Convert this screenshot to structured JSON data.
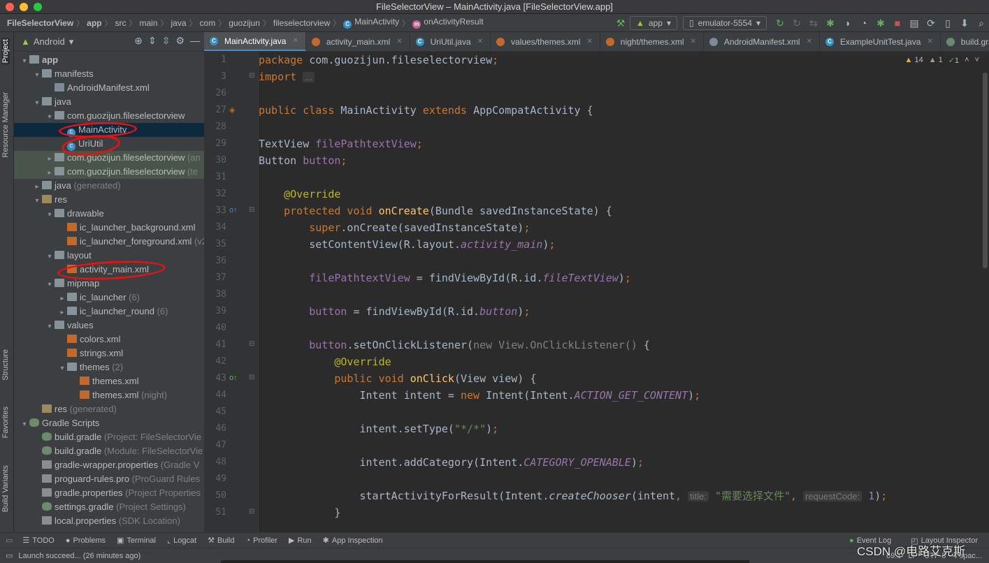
{
  "window": {
    "title": "FileSelectorView – MainActivity.java [FileSelectorView.app]"
  },
  "breadcrumb": [
    "FileSelectorView",
    "app",
    "src",
    "main",
    "java",
    "com",
    "guozijun",
    "fileselectorview",
    "MainActivity",
    "onActivityResult"
  ],
  "toolbar": {
    "run_config": "app",
    "device": "emulator-5554"
  },
  "left_strip": {
    "project": "Project",
    "resource_manager": "Resource Manager",
    "structure": "Structure",
    "favorites": "Favorites",
    "build_variants": "Build Variants"
  },
  "project_panel": {
    "view_mode": "Android"
  },
  "tree": [
    {
      "label": "app",
      "suffix": "",
      "indent": 0,
      "arrow": "v",
      "icon": "folder",
      "bold": true
    },
    {
      "label": "manifests",
      "suffix": "",
      "indent": 1,
      "arrow": "v",
      "icon": "folder"
    },
    {
      "label": "AndroidManifest.xml",
      "suffix": "",
      "indent": 2,
      "arrow": "",
      "icon": "mf"
    },
    {
      "label": "java",
      "suffix": "",
      "indent": 1,
      "arrow": "v",
      "icon": "folder"
    },
    {
      "label": "com.guozijun.fileselectorview",
      "suffix": "",
      "indent": 2,
      "arrow": "v",
      "icon": "folder"
    },
    {
      "label": "MainActivity",
      "suffix": "",
      "indent": 3,
      "arrow": "",
      "icon": "cls",
      "selected": true
    },
    {
      "label": "UriUtil",
      "suffix": "",
      "indent": 3,
      "arrow": "",
      "icon": "cls"
    },
    {
      "label": "com.guozijun.fileselectorview",
      "suffix": " (an",
      "indent": 2,
      "arrow": ">",
      "icon": "folder",
      "tinted": true
    },
    {
      "label": "com.guozijun.fileselectorview",
      "suffix": " (te",
      "indent": 2,
      "arrow": ">",
      "icon": "folder",
      "tinted": true
    },
    {
      "label": "java",
      "suffix": " (generated)",
      "indent": 1,
      "arrow": ">",
      "icon": "folder"
    },
    {
      "label": "res",
      "suffix": "",
      "indent": 1,
      "arrow": "v",
      "icon": "res"
    },
    {
      "label": "drawable",
      "suffix": "",
      "indent": 2,
      "arrow": "v",
      "icon": "folder"
    },
    {
      "label": "ic_launcher_background.xml",
      "suffix": "",
      "indent": 3,
      "arrow": "",
      "icon": "xml"
    },
    {
      "label": "ic_launcher_foreground.xml",
      "suffix": " (v2",
      "indent": 3,
      "arrow": "",
      "icon": "xml"
    },
    {
      "label": "layout",
      "suffix": "",
      "indent": 2,
      "arrow": "v",
      "icon": "folder"
    },
    {
      "label": "activity_main.xml",
      "suffix": "",
      "indent": 3,
      "arrow": "",
      "icon": "xml"
    },
    {
      "label": "mipmap",
      "suffix": "",
      "indent": 2,
      "arrow": "v",
      "icon": "folder"
    },
    {
      "label": "ic_launcher",
      "suffix": " (6)",
      "indent": 3,
      "arrow": ">",
      "icon": "folder"
    },
    {
      "label": "ic_launcher_round",
      "suffix": " (6)",
      "indent": 3,
      "arrow": ">",
      "icon": "folder"
    },
    {
      "label": "values",
      "suffix": "",
      "indent": 2,
      "arrow": "v",
      "icon": "folder"
    },
    {
      "label": "colors.xml",
      "suffix": "",
      "indent": 3,
      "arrow": "",
      "icon": "xml"
    },
    {
      "label": "strings.xml",
      "suffix": "",
      "indent": 3,
      "arrow": "",
      "icon": "xml"
    },
    {
      "label": "themes",
      "suffix": " (2)",
      "indent": 3,
      "arrow": "v",
      "icon": "folder"
    },
    {
      "label": "themes.xml",
      "suffix": "",
      "indent": 4,
      "arrow": "",
      "icon": "xml"
    },
    {
      "label": "themes.xml",
      "suffix": " (night)",
      "indent": 4,
      "arrow": "",
      "icon": "xml"
    },
    {
      "label": "res",
      "suffix": " (generated)",
      "indent": 1,
      "arrow": "",
      "icon": "res"
    },
    {
      "label": "Gradle Scripts",
      "suffix": "",
      "indent": 0,
      "arrow": "v",
      "icon": "gradle"
    },
    {
      "label": "build.gradle",
      "suffix": " (Project: FileSelectorVie",
      "indent": 1,
      "arrow": "",
      "icon": "gradle"
    },
    {
      "label": "build.gradle",
      "suffix": " (Module: FileSelectorVie",
      "indent": 1,
      "arrow": "",
      "icon": "gradle"
    },
    {
      "label": "gradle-wrapper.properties",
      "suffix": " (Gradle V",
      "indent": 1,
      "arrow": "",
      "icon": "prop"
    },
    {
      "label": "proguard-rules.pro",
      "suffix": " (ProGuard Rules",
      "indent": 1,
      "arrow": "",
      "icon": "prop"
    },
    {
      "label": "gradle.properties",
      "suffix": " (Project Properties",
      "indent": 1,
      "arrow": "",
      "icon": "prop"
    },
    {
      "label": "settings.gradle",
      "suffix": " (Project Settings)",
      "indent": 1,
      "arrow": "",
      "icon": "gradle"
    },
    {
      "label": "local.properties",
      "suffix": " (SDK Location)",
      "indent": 1,
      "arrow": "",
      "icon": "prop"
    }
  ],
  "tabs": [
    {
      "label": "MainActivity.java",
      "icon": "cls",
      "active": true
    },
    {
      "label": "activity_main.xml",
      "icon": "xml"
    },
    {
      "label": "UriUtil.java",
      "icon": "cls"
    },
    {
      "label": "values/themes.xml",
      "icon": "xml"
    },
    {
      "label": "night/themes.xml",
      "icon": "xml"
    },
    {
      "label": "AndroidManifest.xml",
      "icon": "mf"
    },
    {
      "label": "ExampleUnitTest.java",
      "icon": "cls"
    },
    {
      "label": "build.gradle (:app)",
      "icon": "gradle"
    }
  ],
  "inspections": {
    "warnings": "14",
    "weak_warnings": "1",
    "ok": "1"
  },
  "code_lines": [
    {
      "n": "1",
      "t": [
        [
          "package ",
          "kw"
        ],
        [
          "com.guozijun.fileselectorview",
          ""
        ],
        [
          ";",
          "kw"
        ]
      ]
    },
    {
      "n": "3",
      "t": [
        [
          "import ",
          "kw"
        ],
        [
          "...",
          "hint"
        ]
      ]
    },
    {
      "n": "26",
      "t": []
    },
    {
      "n": "27",
      "t": [
        [
          "public class ",
          "kw"
        ],
        [
          "MainActivity ",
          ""
        ],
        [
          "extends ",
          "kw"
        ],
        [
          "AppCompatActivity {",
          ""
        ]
      ]
    },
    {
      "n": "28",
      "t": []
    },
    {
      "n": "29",
      "t": [
        [
          "TextView ",
          ""
        ],
        [
          "filePathtextView",
          "fld"
        ],
        [
          ";",
          "kw"
        ]
      ]
    },
    {
      "n": "30",
      "t": [
        [
          "Button ",
          ""
        ],
        [
          "button",
          "fld"
        ],
        [
          ";",
          "kw"
        ]
      ]
    },
    {
      "n": "31",
      "t": []
    },
    {
      "n": "32",
      "t": [
        [
          "    @Override",
          "ann"
        ]
      ]
    },
    {
      "n": "33",
      "t": [
        [
          "    protected void ",
          "kw"
        ],
        [
          "onCreate",
          "fn"
        ],
        [
          "(Bundle savedInstanceState) {",
          ""
        ]
      ]
    },
    {
      "n": "34",
      "t": [
        [
          "        super",
          "kw"
        ],
        [
          ".onCreate(savedInstanceState)",
          ""
        ],
        [
          ";",
          "kw"
        ]
      ]
    },
    {
      "n": "35",
      "t": [
        [
          "        setContentView(R.layout.",
          ""
        ],
        [
          "activity_main",
          "ital"
        ],
        [
          ")",
          ""
        ],
        [
          ";",
          "kw"
        ]
      ]
    },
    {
      "n": "36",
      "t": []
    },
    {
      "n": "37",
      "t": [
        [
          "        filePathtextView",
          "fld"
        ],
        [
          " = findViewById(R.id.",
          ""
        ],
        [
          "fileTextView",
          "ital"
        ],
        [
          ")",
          ""
        ],
        [
          ";",
          "kw"
        ]
      ]
    },
    {
      "n": "38",
      "t": []
    },
    {
      "n": "39",
      "t": [
        [
          "        button",
          "fld"
        ],
        [
          " = findViewById(R.id.",
          ""
        ],
        [
          "button",
          "ital"
        ],
        [
          ")",
          ""
        ],
        [
          ";",
          "kw"
        ]
      ]
    },
    {
      "n": "40",
      "t": []
    },
    {
      "n": "41",
      "t": [
        [
          "        button",
          "fld"
        ],
        [
          ".setOnClickListener(",
          ""
        ],
        [
          "new View.OnClickListener()",
          "dimtext"
        ],
        [
          " {",
          ""
        ]
      ]
    },
    {
      "n": "42",
      "t": [
        [
          "            @Override",
          "ann"
        ]
      ]
    },
    {
      "n": "43",
      "t": [
        [
          "            public void ",
          "kw"
        ],
        [
          "onClick",
          "fn"
        ],
        [
          "(View view) {",
          ""
        ]
      ]
    },
    {
      "n": "44",
      "t": [
        [
          "                Intent intent = ",
          ""
        ],
        [
          "new ",
          "kw"
        ],
        [
          "Intent(Intent.",
          ""
        ],
        [
          "ACTION_GET_CONTENT",
          "ital"
        ],
        [
          ")",
          ""
        ],
        [
          ";",
          "kw"
        ]
      ]
    },
    {
      "n": "45",
      "t": []
    },
    {
      "n": "46",
      "t": [
        [
          "                intent.setType(",
          ""
        ],
        [
          "\"*/*\"",
          "str"
        ],
        [
          ")",
          ""
        ],
        [
          ";",
          "kw"
        ]
      ]
    },
    {
      "n": "47",
      "t": []
    },
    {
      "n": "48",
      "t": [
        [
          "                intent.addCategory(Intent.",
          ""
        ],
        [
          "CATEGORY_OPENABLE",
          "ital"
        ],
        [
          ")",
          ""
        ],
        [
          ";",
          "kw"
        ]
      ]
    },
    {
      "n": "49",
      "t": []
    },
    {
      "n": "50",
      "t": [
        [
          "                startActivityForResult(Intent.",
          ""
        ],
        [
          "createChooser",
          "mi"
        ],
        [
          "(intent",
          ""
        ],
        [
          ", ",
          "kw"
        ],
        [
          "title:",
          "hint"
        ],
        [
          " ",
          ""
        ],
        [
          "\"需要选择文件\"",
          "str"
        ],
        [
          ", ",
          "kw"
        ],
        [
          "requestCode:",
          "hint"
        ],
        [
          " ",
          ""
        ],
        [
          "1",
          "num"
        ],
        [
          ")",
          ""
        ],
        [
          ";",
          "kw"
        ]
      ]
    },
    {
      "n": "51",
      "t": [
        [
          "            }",
          ""
        ]
      ]
    }
  ],
  "bottom_tools": [
    {
      "label": "TODO",
      "icon": "list-icon"
    },
    {
      "label": "Problems",
      "icon": "problems-icon"
    },
    {
      "label": "Terminal",
      "icon": "terminal-icon"
    },
    {
      "label": "Logcat",
      "icon": "logcat-icon"
    },
    {
      "label": "Build",
      "icon": "hammer-icon"
    },
    {
      "label": "Profiler",
      "icon": "profiler-icon"
    },
    {
      "label": "Run",
      "icon": "run-icon"
    },
    {
      "label": "App Inspection",
      "icon": "inspection-icon"
    }
  ],
  "bottom_right": {
    "event_log": "Event Log",
    "layout_inspector": "Layout Inspector"
  },
  "status": {
    "message": "Launch succeed... (26 minutes ago)",
    "position": "69:1",
    "line_sep": "LF",
    "encoding": "UTF-8",
    "indent": "4 spac..."
  },
  "watermark": "CSDN @电路艾克斯",
  "colors": {
    "annotation": "#e41313",
    "selection": "#0d293e",
    "accent": "#4a88c7"
  }
}
